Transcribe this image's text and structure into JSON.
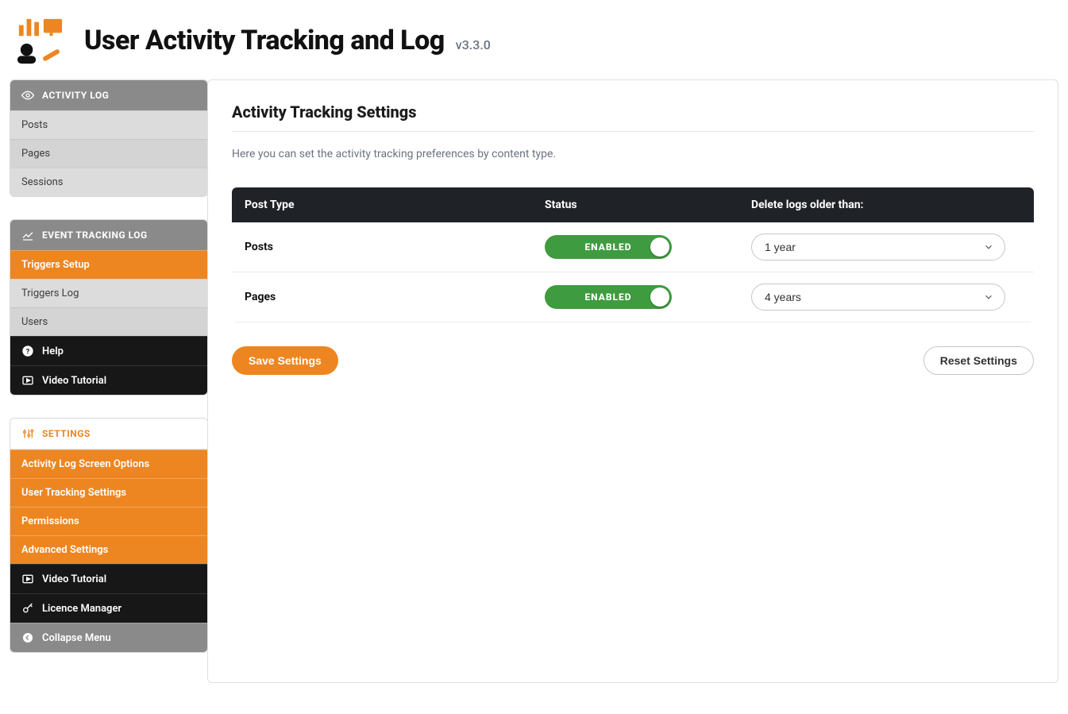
{
  "header": {
    "title": "User Activity Tracking and Log",
    "version": "v3.3.0"
  },
  "sidebar": {
    "panel1": {
      "title": "ACTIVITY LOG",
      "items": [
        {
          "label": "Posts"
        },
        {
          "label": "Pages"
        },
        {
          "label": "Sessions"
        }
      ]
    },
    "panel2": {
      "title": "EVENT TRACKING LOG",
      "items": [
        {
          "label": "Triggers Setup"
        },
        {
          "label": "Triggers Log"
        },
        {
          "label": "Users"
        },
        {
          "label": "Help"
        },
        {
          "label": "Video Tutorial"
        }
      ]
    },
    "panel3": {
      "title": "SETTINGS",
      "items": [
        {
          "label": "Activity Log Screen Options"
        },
        {
          "label": "User Tracking Settings"
        },
        {
          "label": "Permissions"
        },
        {
          "label": "Advanced Settings"
        },
        {
          "label": "Video Tutorial"
        },
        {
          "label": "Licence Manager"
        },
        {
          "label": "Collapse Menu"
        }
      ]
    }
  },
  "main": {
    "heading": "Activity Tracking Settings",
    "description": "Here you can set the activity tracking preferences by content type.",
    "columns": {
      "type": "Post Type",
      "status": "Status",
      "delete": "Delete logs older than:"
    },
    "rows": [
      {
        "name": "Posts",
        "status_label": "ENABLED",
        "retention": "1 year"
      },
      {
        "name": "Pages",
        "status_label": "ENABLED",
        "retention": "4 years"
      }
    ],
    "save_label": "Save Settings",
    "reset_label": "Reset Settings"
  }
}
